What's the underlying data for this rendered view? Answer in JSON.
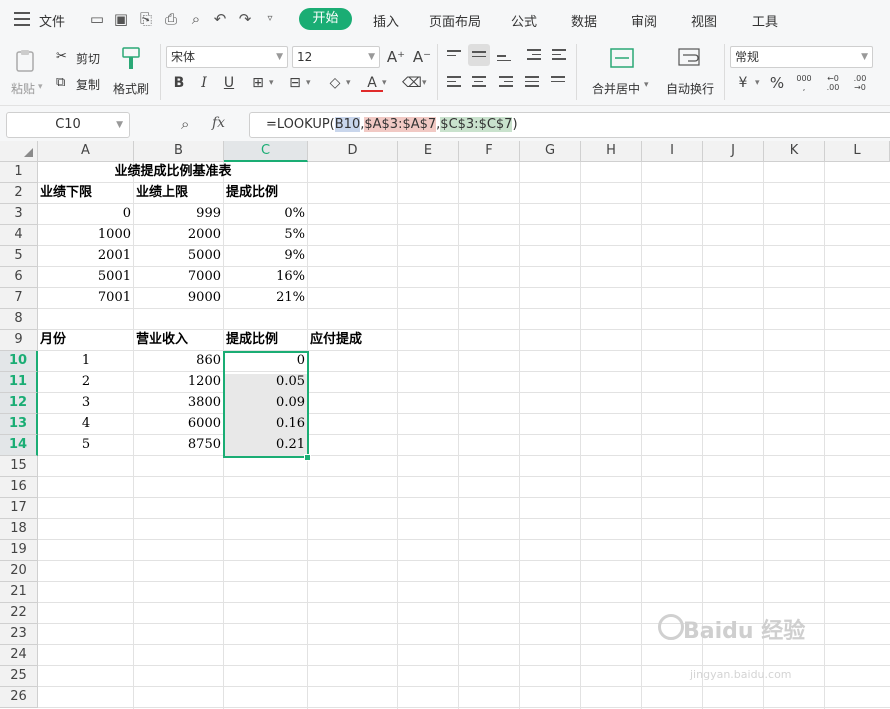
{
  "menu": {
    "file": "文件",
    "tabs": [
      "开始",
      "插入",
      "页面布局",
      "公式",
      "数据",
      "审阅",
      "视图",
      "工具"
    ]
  },
  "ribbon": {
    "paste": "粘贴",
    "cut": "剪切",
    "copy": "复制",
    "format_painter": "格式刷",
    "font_name": "宋体",
    "font_size": "12",
    "merge_center": "合并居中",
    "wrap_text": "自动换行",
    "number_format": "常规",
    "percent": "%"
  },
  "formula_bar": {
    "name_box": "C10",
    "fx": "fx",
    "f_prefix": "=LOOKUP(",
    "ref1": "B10",
    "comma1": ",",
    "ref2": "$A$3:$A$7",
    "comma2": ",",
    "ref3": "$C$3:$C$7",
    "f_suffix": ")"
  },
  "columns": [
    "A",
    "B",
    "C",
    "D",
    "E",
    "F",
    "G",
    "H",
    "I",
    "J",
    "K",
    "L"
  ],
  "rows": [
    "1",
    "2",
    "3",
    "4",
    "5",
    "6",
    "7",
    "8",
    "9",
    "10",
    "11",
    "12",
    "13",
    "14",
    "15",
    "16",
    "17",
    "18",
    "19",
    "20",
    "21",
    "22",
    "23",
    "24",
    "25",
    "26"
  ],
  "cells": {
    "title": "业绩提成比例基准表",
    "r2": [
      "业绩下限",
      "业绩上限",
      "提成比例"
    ],
    "r3": [
      "0",
      "999",
      "0%"
    ],
    "r4": [
      "1000",
      "2000",
      "5%"
    ],
    "r5": [
      "2001",
      "5000",
      "9%"
    ],
    "r6": [
      "5001",
      "7000",
      "16%"
    ],
    "r7": [
      "7001",
      "9000",
      "21%"
    ],
    "r9": [
      "月份",
      "营业收入",
      "提成比例",
      "应付提成"
    ],
    "r10": [
      "1",
      "860",
      "0"
    ],
    "r11": [
      "2",
      "1200",
      "0.05"
    ],
    "r12": [
      "3",
      "3800",
      "0.09"
    ],
    "r13": [
      "4",
      "6000",
      "0.16"
    ],
    "r14": [
      "5",
      "8750",
      "0.21"
    ]
  },
  "selection": {
    "column": "C",
    "rows": [
      "10",
      "11",
      "12",
      "13",
      "14"
    ]
  },
  "colors": {
    "accent": "#1aad74"
  },
  "watermark": {
    "brand": "Baidu 经验",
    "url": "jingyan.baidu.com"
  }
}
